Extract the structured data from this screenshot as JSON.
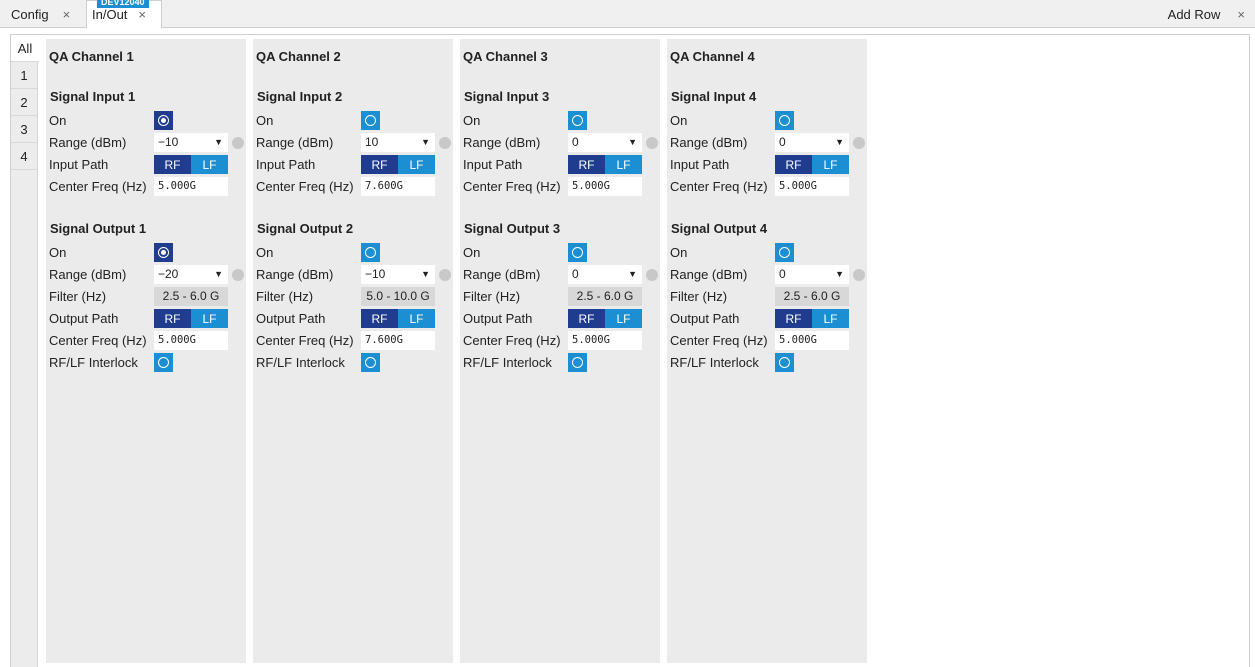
{
  "tabs": [
    {
      "label": "Config",
      "close": "×"
    },
    {
      "label": "In/Out",
      "close": "×",
      "badge": "DEV12040"
    }
  ],
  "add_row": {
    "label": "Add Row",
    "close": "×"
  },
  "side_tabs": [
    "All",
    "1",
    "2",
    "3",
    "4"
  ],
  "labels": {
    "on": "On",
    "range": "Range (dBm)",
    "input_path": "Input Path",
    "output_path": "Output Path",
    "center_freq": "Center Freq (Hz)",
    "filter": "Filter (Hz)",
    "interlock": "RF/LF Interlock",
    "rf": "RF",
    "lf": "LF",
    "arrow": "▼"
  },
  "colors": {
    "accent": "#1c8fd3",
    "accent_dark": "#1f3c8f",
    "panel": "#ebebeb"
  },
  "channels": [
    {
      "title": "QA Channel 1",
      "input": {
        "title": "Signal Input 1",
        "on": true,
        "range": "−10",
        "center_freq": "5.000G"
      },
      "output": {
        "title": "Signal Output 1",
        "on": true,
        "range": "−20",
        "filter": "2.5 - 6.0 G",
        "center_freq": "5.000G",
        "interlock": false
      }
    },
    {
      "title": "QA Channel 2",
      "input": {
        "title": "Signal Input 2",
        "on": false,
        "range": "10",
        "center_freq": "7.600G"
      },
      "output": {
        "title": "Signal Output 2",
        "on": false,
        "range": "−10",
        "filter": "5.0 - 10.0 G",
        "center_freq": "7.600G",
        "interlock": false
      }
    },
    {
      "title": "QA Channel 3",
      "input": {
        "title": "Signal Input 3",
        "on": false,
        "range": "0",
        "center_freq": "5.000G"
      },
      "output": {
        "title": "Signal Output 3",
        "on": false,
        "range": "0",
        "filter": "2.5 - 6.0 G",
        "center_freq": "5.000G",
        "interlock": false
      }
    },
    {
      "title": "QA Channel 4",
      "input": {
        "title": "Signal Input 4",
        "on": false,
        "range": "0",
        "center_freq": "5.000G"
      },
      "output": {
        "title": "Signal Output 4",
        "on": false,
        "range": "0",
        "filter": "2.5 - 6.0 G",
        "center_freq": "5.000G",
        "interlock": false
      }
    }
  ]
}
